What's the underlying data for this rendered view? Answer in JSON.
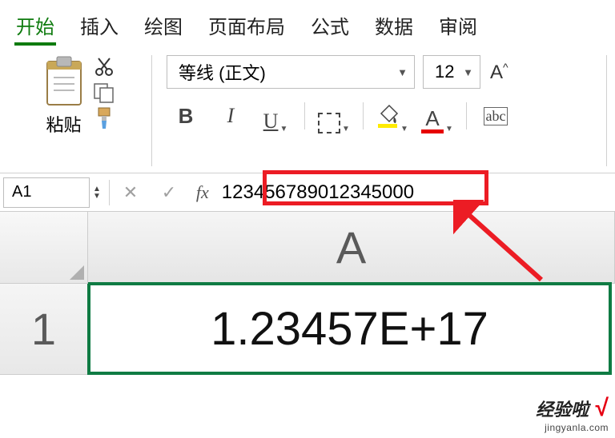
{
  "tabs": {
    "items": [
      "开始",
      "插入",
      "绘图",
      "页面布局",
      "公式",
      "数据",
      "审阅"
    ],
    "active_index": 0
  },
  "ribbon": {
    "paste_label": "粘贴",
    "font_name": "等线 (正文)",
    "font_size": "12",
    "bold": "B",
    "italic": "I",
    "underline": "U",
    "fontcolor_letter": "A",
    "increase_font": "A^",
    "ruby": "abc"
  },
  "namebox": {
    "ref": "A1",
    "fx": "fx",
    "formula": "123456789012345000"
  },
  "sheet": {
    "col": "A",
    "row": "1",
    "cell_value": "1.23457E+17"
  },
  "watermark": {
    "line1": "经验啦",
    "line2": "jingyanla.com",
    "check": "√"
  },
  "colors": {
    "accent": "#0F7B0F",
    "highlight_fill": "#FFEB00",
    "font_color_bar": "#E60000",
    "annotation": "#EC1C24"
  }
}
